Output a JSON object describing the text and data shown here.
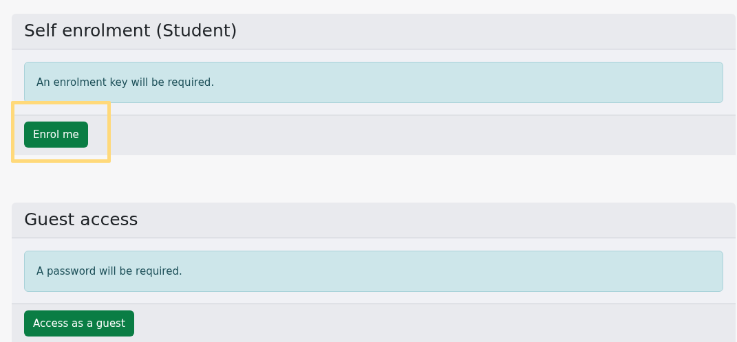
{
  "sections": [
    {
      "title": "Self enrolment (Student)",
      "notice": "An enrolment key will be required.",
      "button": {
        "label": "Enrol me",
        "highlighted": true
      }
    },
    {
      "title": "Guest access",
      "notice": "A password will be required.",
      "button": {
        "label": "Access as a guest",
        "highlighted": false
      }
    }
  ]
}
